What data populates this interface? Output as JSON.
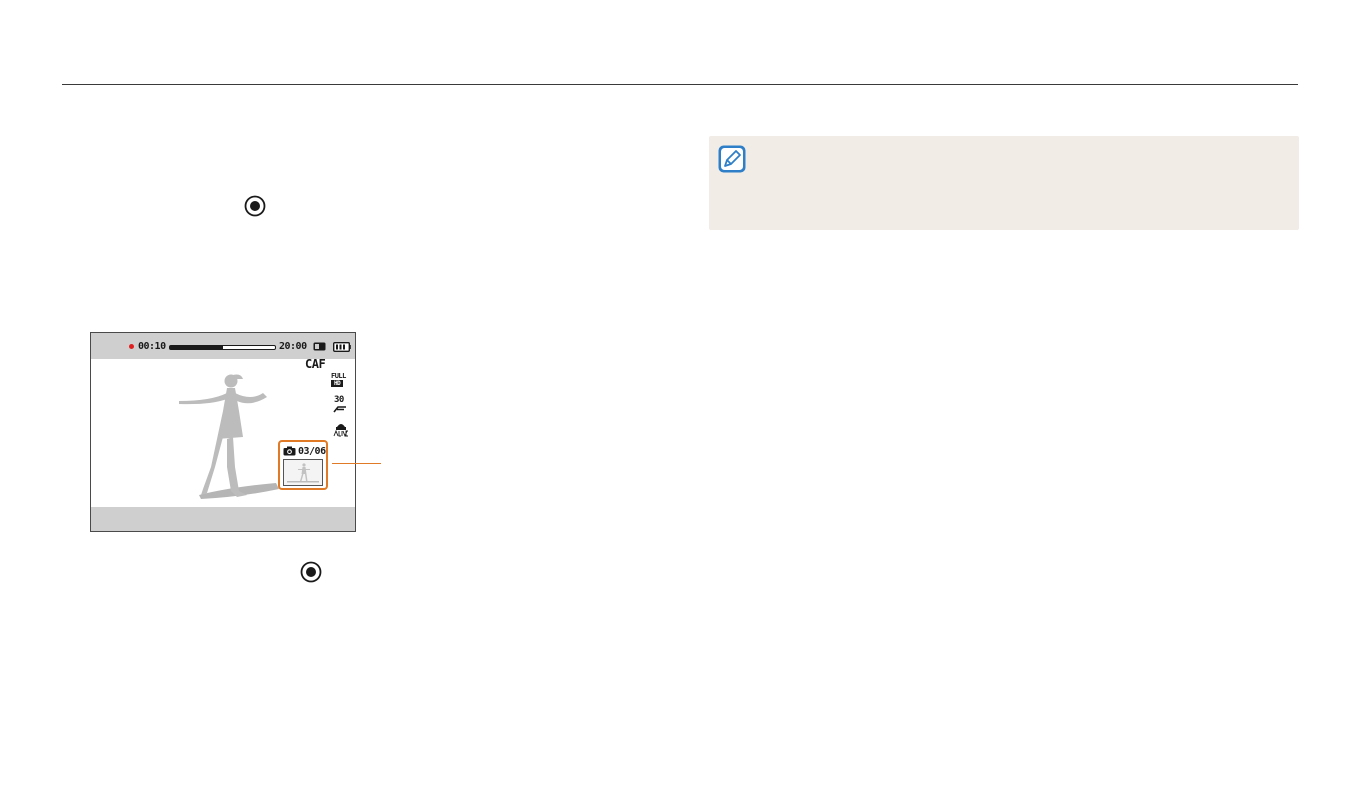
{
  "camera_screen": {
    "rec_time": "00:10",
    "remaining_time": "20:00",
    "record_progress": 0.5,
    "focus_mode": "CAF",
    "resolution_top": "FULL",
    "resolution_bottom": "HD",
    "frame_rate": "30",
    "capture_count": "03/06",
    "colors": {
      "rec": "#e02020",
      "highlight": "#e07a26",
      "bar": "#cfcfcf"
    }
  },
  "icons": {
    "shutter_1": "shutter-button-icon",
    "shutter_2": "shutter-button-icon",
    "note": "note-pencil-icon"
  },
  "colors": {
    "note_background": "#f1ece6",
    "note_icon": "#2f7fc8"
  }
}
